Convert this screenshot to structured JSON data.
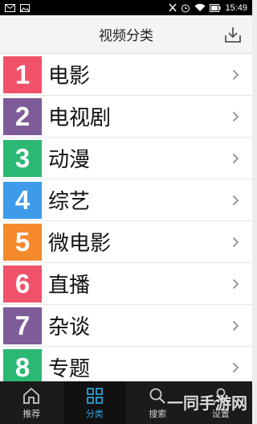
{
  "status_bar": {
    "time": "15:49",
    "icons": [
      "mail-icon",
      "image-icon",
      "sim-icon",
      "alarm-icon",
      "wifi-icon",
      "battery-icon"
    ]
  },
  "header": {
    "title": "视频分类",
    "right_icon": "download-icon"
  },
  "categories": [
    {
      "num": "1",
      "label": "电影",
      "color": "#f0526a"
    },
    {
      "num": "2",
      "label": "电视剧",
      "color": "#7e5c99"
    },
    {
      "num": "3",
      "label": "动漫",
      "color": "#2bb873"
    },
    {
      "num": "4",
      "label": "综艺",
      "color": "#3d9bea"
    },
    {
      "num": "5",
      "label": "微电影",
      "color": "#f58a2d"
    },
    {
      "num": "6",
      "label": "直播",
      "color": "#f0526a"
    },
    {
      "num": "7",
      "label": "杂谈",
      "color": "#7e5c99"
    },
    {
      "num": "8",
      "label": "专题",
      "color": "#2bb873"
    }
  ],
  "tabbar": {
    "tabs": [
      {
        "label": "推荐",
        "icon": "home-icon",
        "active": false
      },
      {
        "label": "分类",
        "icon": "grid-icon",
        "active": true
      },
      {
        "label": "搜索",
        "icon": "search-icon",
        "active": false
      },
      {
        "label": "设置",
        "icon": "user-icon",
        "active": false
      }
    ]
  },
  "watermark": {
    "text": "一同手游网"
  }
}
